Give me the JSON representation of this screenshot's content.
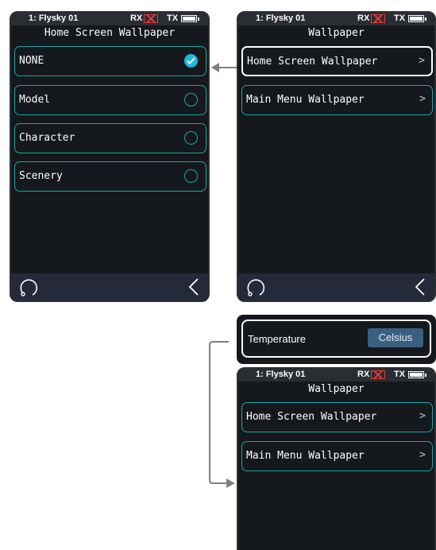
{
  "status": {
    "model": "1: Flysky 01",
    "rx": "RX",
    "tx": "TX"
  },
  "screen_left": {
    "title": "Home Screen Wallpaper",
    "options": [
      {
        "label": "NONE",
        "selected": true
      },
      {
        "label": "Model",
        "selected": false
      },
      {
        "label": "Character",
        "selected": false
      },
      {
        "label": "Scenery",
        "selected": false
      }
    ]
  },
  "screen_right": {
    "title": "Wallpaper",
    "items": [
      {
        "label": "Home Screen Wallpaper",
        "chevron": ">"
      },
      {
        "label": "Main Menu Wallpaper",
        "chevron": ">"
      }
    ]
  },
  "temperature": {
    "label": "Temperature",
    "value": "Celsius"
  },
  "screen_bottom": {
    "title": "Wallpaper",
    "items": [
      {
        "label": "Home Screen Wallpaper",
        "chevron": ">"
      },
      {
        "label": "Main Menu Wallpaper",
        "chevron": ">"
      }
    ]
  },
  "colors": {
    "accent": "#1aa8a8",
    "check": "#1fb8e0",
    "rx_error": "#e23b3b",
    "screen_bg": "#15181c",
    "bottombar": "#242a3a"
  },
  "icons": [
    "undo-icon",
    "back-icon",
    "check-icon",
    "battery-icon"
  ]
}
